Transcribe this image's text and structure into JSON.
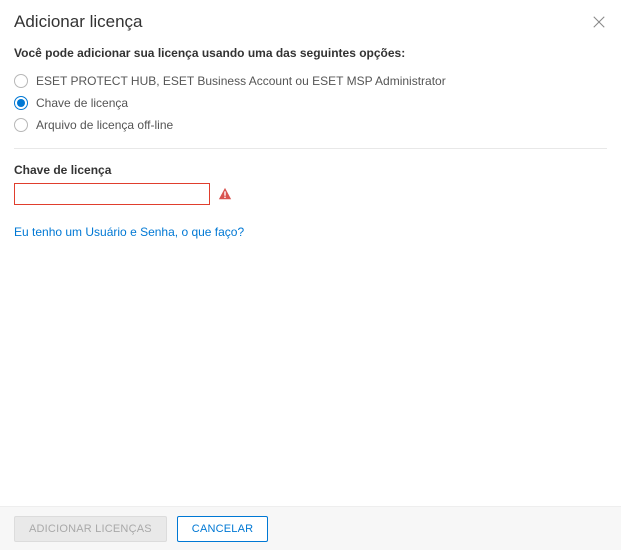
{
  "header": {
    "title": "Adicionar licença"
  },
  "prompt": "Você pode adicionar sua licença usando uma das seguintes opções:",
  "options": [
    {
      "label": "ESET PROTECT HUB, ESET Business Account ou ESET MSP Administrator",
      "selected": false
    },
    {
      "label": "Chave de licença",
      "selected": true
    },
    {
      "label": "Arquivo de licença off-line",
      "selected": false
    }
  ],
  "field": {
    "label": "Chave de licença",
    "value": ""
  },
  "help_link": "Eu tenho um Usuário e Senha, o que faço?",
  "footer": {
    "primary": "ADICIONAR LICENÇAS",
    "secondary": "CANCELAR"
  }
}
